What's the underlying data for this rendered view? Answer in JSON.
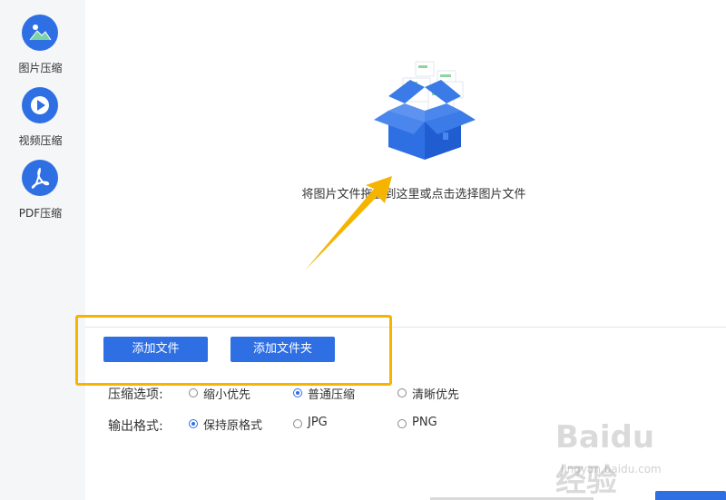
{
  "sidebar": {
    "items": [
      {
        "label": "图片压缩",
        "icon": "image-icon"
      },
      {
        "label": "视频压缩",
        "icon": "play-icon"
      },
      {
        "label": "PDF压缩",
        "icon": "pdf-icon"
      }
    ]
  },
  "dropzone": {
    "icon": "open-box-icon",
    "text": "将图片文件拖放到这里或点击选择图片文件"
  },
  "toolbar": {
    "add_file_label": "添加文件",
    "add_folder_label": "添加文件夹"
  },
  "compression_options": {
    "label": "压缩选项:",
    "options": [
      "缩小优先",
      "普通压缩",
      "清晰优先"
    ],
    "selected": "普通压缩"
  },
  "output_format": {
    "label": "输出格式:",
    "options": [
      "保持原格式",
      "JPG",
      "PNG"
    ],
    "selected": "保持原格式"
  },
  "watermark": {
    "logo": "Baidu 经验",
    "url": "jingyan.baidu.com"
  },
  "colors": {
    "accent": "#2f6fe4",
    "highlight": "#f5b400",
    "sidebar_bg": "#f5f6f7"
  }
}
